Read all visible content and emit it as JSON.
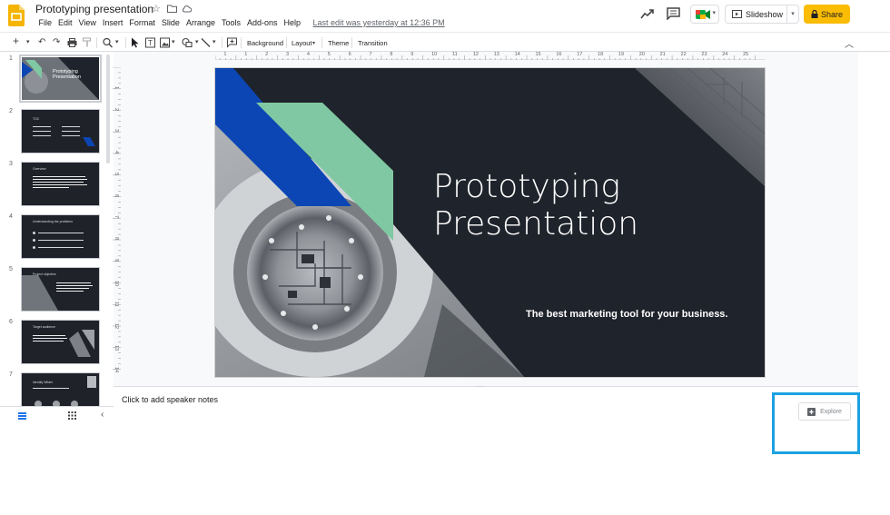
{
  "document": {
    "title": "Prototyping presentation",
    "last_edit": "Last edit was yesterday at 12:36 PM"
  },
  "menu": [
    "File",
    "Edit",
    "View",
    "Insert",
    "Format",
    "Slide",
    "Arrange",
    "Tools",
    "Add-ons",
    "Help"
  ],
  "header": {
    "slideshow_label": "Slideshow",
    "share_label": "Share"
  },
  "toolbar": {
    "background_label": "Background",
    "layout_label": "Layout",
    "theme_label": "Theme",
    "transition_label": "Transition"
  },
  "ruler": {
    "horizontal": [
      "1",
      "1",
      "2",
      "3",
      "4",
      "5",
      "6",
      "7",
      "8",
      "9",
      "10",
      "11",
      "12",
      "13",
      "14",
      "15",
      "16",
      "17",
      "18",
      "19",
      "20",
      "21",
      "22",
      "23",
      "24",
      "25"
    ],
    "vertical": [
      "1",
      "2",
      "3",
      "4",
      "5",
      "6",
      "7",
      "8",
      "9",
      "10",
      "11",
      "12",
      "13",
      "14"
    ]
  },
  "filmstrip": {
    "slides": [
      {
        "num": "1",
        "title": "Prototyping Presentation"
      },
      {
        "num": "2",
        "title": "TOC"
      },
      {
        "num": "3",
        "title": "Overview"
      },
      {
        "num": "4",
        "title": "Understanding the problems"
      },
      {
        "num": "5",
        "title": "Project objective"
      },
      {
        "num": "6",
        "title": "Target audience"
      },
      {
        "num": "7",
        "title": "Identify Wilder"
      }
    ]
  },
  "slide": {
    "title_line1": "Prototyping",
    "title_line2": "Presentation",
    "subtitle": "The best marketing tool for your business."
  },
  "notes": {
    "placeholder": "Click to add speaker notes"
  },
  "explore": {
    "label": "Explore"
  },
  "colors": {
    "slide_bg": "#1f232b",
    "accent_blue": "#0b46b4",
    "accent_green": "#80c7a3",
    "share": "#fbbc04",
    "highlight": "#1ba1e2"
  }
}
